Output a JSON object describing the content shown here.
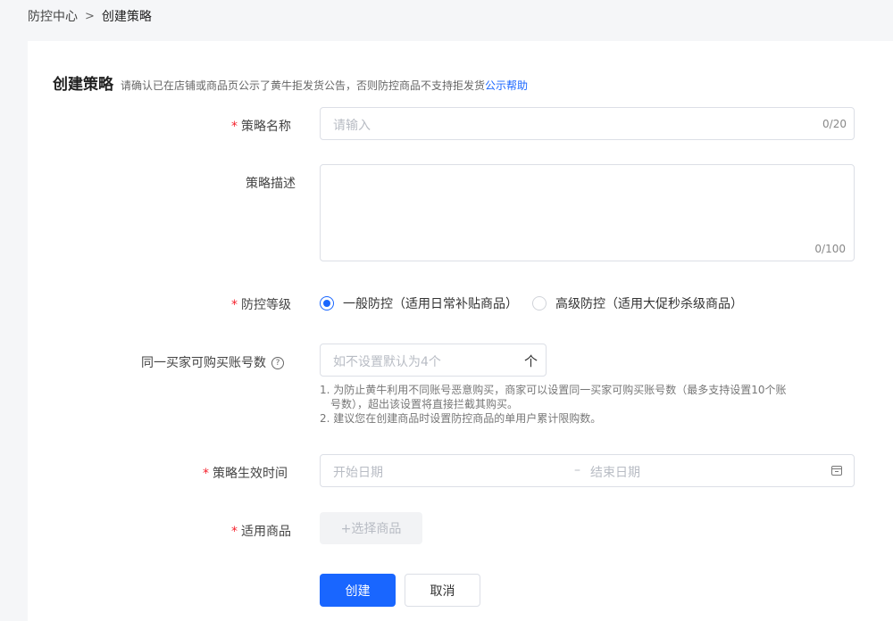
{
  "breadcrumb": {
    "parent": "防控中心",
    "separator": ">",
    "current": "创建策略"
  },
  "header": {
    "title": "创建策略",
    "notice": "请确认已在店铺或商品页公示了黄牛拒发货公告，否则防控商品不支持拒发货",
    "notice_link": "公示帮助"
  },
  "form": {
    "name": {
      "label": "策略名称",
      "placeholder": "请输入",
      "counter": "0/20",
      "required": true
    },
    "description": {
      "label": "策略描述",
      "counter": "0/100"
    },
    "level": {
      "label": "防控等级",
      "options": [
        {
          "label": "一般防控（适用日常补贴商品）",
          "checked": true
        },
        {
          "label": "高级防控（适用大促秒杀级商品）",
          "checked": false
        }
      ]
    },
    "accounts": {
      "label": "同一买家可购买账号数",
      "help_icon": "question-circle-icon",
      "placeholder": "如不设置默认为4个",
      "stepper_glyph": "个",
      "hint1_line1": "1. 为防止黄牛利用不同账号恶意购买，商家可以设置同一买家可购买账号数（最多支持设置10个账",
      "hint1_line2": "号数），超出该设置将直接拦截其购买。",
      "hint2": "2. 建议您在创建商品时设置防控商品的单用户累计限购数。"
    },
    "effective_time": {
      "label": "策略生效时间",
      "start_placeholder": "开始日期",
      "separator": "–",
      "end_placeholder": "结束日期",
      "icon": "calendar-icon"
    },
    "products": {
      "label": "适用商品",
      "select_button": "+选择商品"
    }
  },
  "actions": {
    "create": "创建",
    "cancel": "取消"
  },
  "colors": {
    "primary": "#1966ff",
    "required": "#f5222d",
    "background": "#f5f6f8"
  }
}
